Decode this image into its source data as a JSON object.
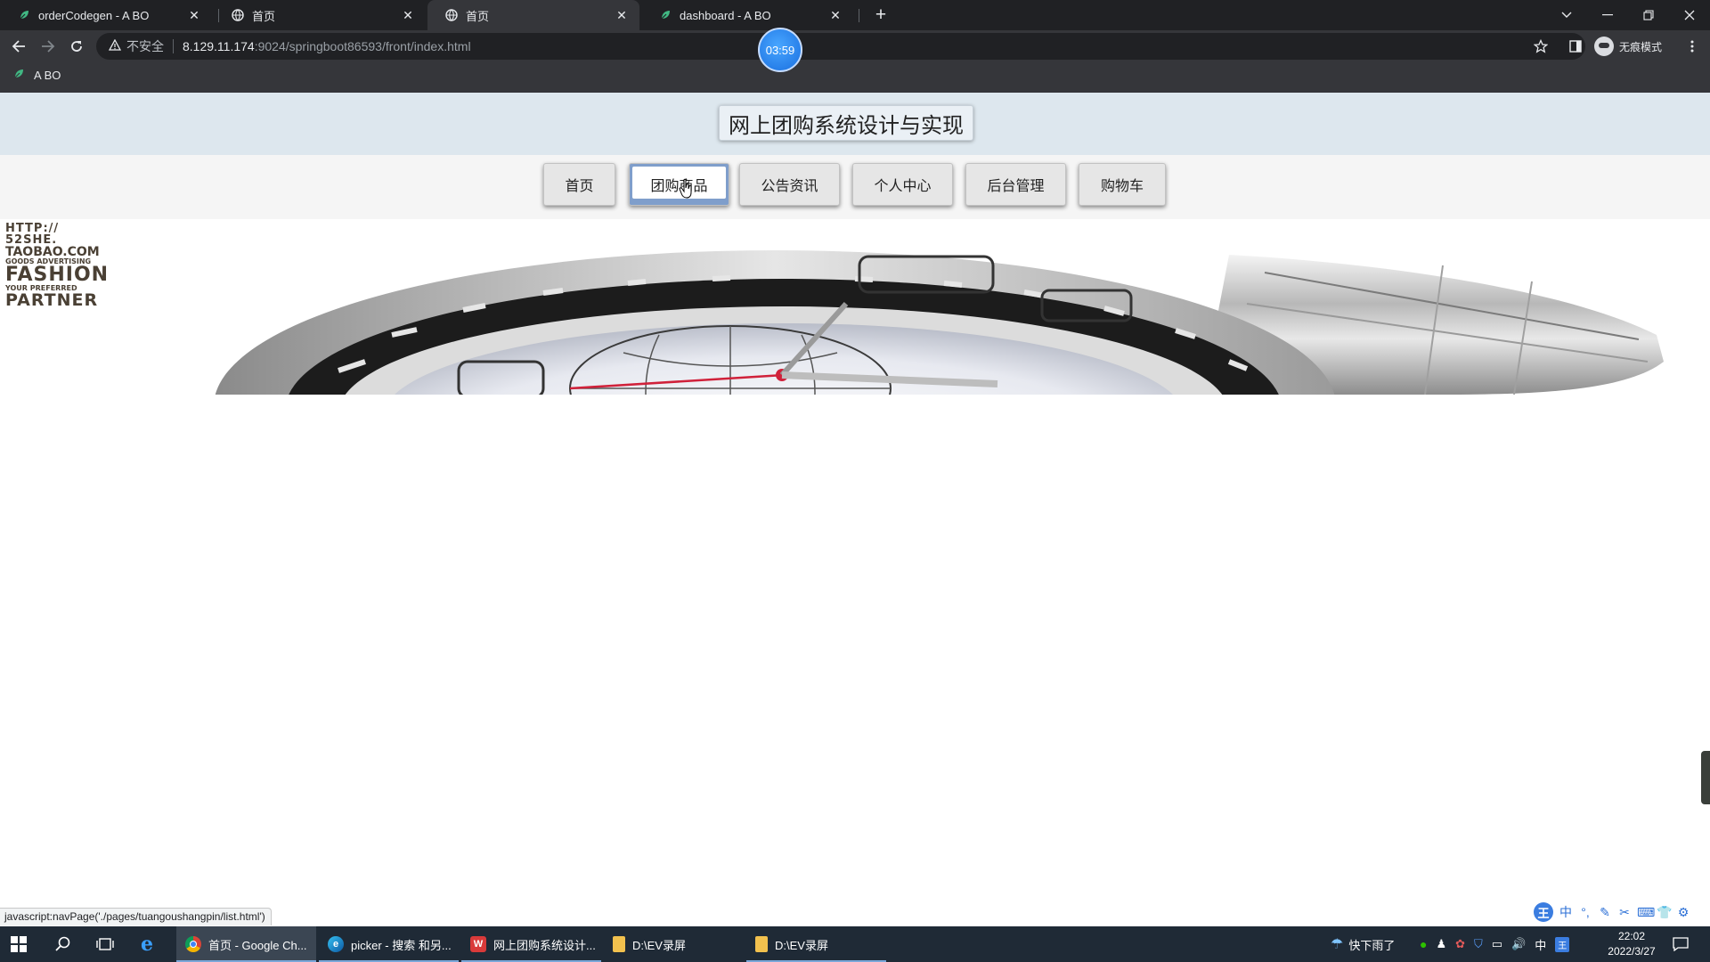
{
  "browser": {
    "tabs": [
      {
        "title": "orderCodegen - A BO",
        "favicon": "abo-leaf-icon",
        "active": false
      },
      {
        "title": "首页",
        "favicon": "globe-icon",
        "active": false
      },
      {
        "title": "首页",
        "favicon": "globe-icon",
        "active": true
      },
      {
        "title": "dashboard - A BO",
        "favicon": "abo-leaf-icon",
        "active": false
      }
    ],
    "address": {
      "security_label": "不安全",
      "host": "8.129.11.174",
      "path": ":9024/springboot86593/front/index.html"
    },
    "recording_timer": "03:59",
    "profile_label": "无痕模式",
    "bookmarks": [
      {
        "label": "A BO"
      }
    ]
  },
  "site": {
    "title": "网上团购系统设计与实现",
    "nav": [
      {
        "label": "首页"
      },
      {
        "label": "团购商品"
      },
      {
        "label": "公告资讯"
      },
      {
        "label": "个人中心"
      },
      {
        "label": "后台管理"
      },
      {
        "label": "购物车"
      }
    ],
    "active_nav": "团购商品",
    "banner_logo_lines": [
      "HTTP://",
      "52SHE.",
      "TAOBAO.COM",
      "GOODS ADVERTISING",
      "FASHION",
      "YOUR PREFERRED",
      "PARTNER"
    ]
  },
  "status_link": "javascript:navPage('./pages/tuangoushangpin/list.html')",
  "ime": {
    "logo": "王",
    "mode": "中"
  },
  "taskbar": {
    "apps": [
      {
        "label": "首页 - Google Ch...",
        "icon": "chrome-icon",
        "active": true
      },
      {
        "label": "picker - 搜索 和另...",
        "icon": "edge-icon",
        "active": false
      },
      {
        "label": "网上团购系统设计...",
        "icon": "wps-icon",
        "active": false
      },
      {
        "label": "D:\\EV录屏",
        "icon": "folder-icon",
        "active": false
      },
      {
        "label": "D:\\EV录屏",
        "icon": "folder-icon",
        "active": false
      }
    ],
    "weather": "快下雨了",
    "ime_indicator": "中",
    "time": "22:02",
    "date": "2022/3/27"
  }
}
